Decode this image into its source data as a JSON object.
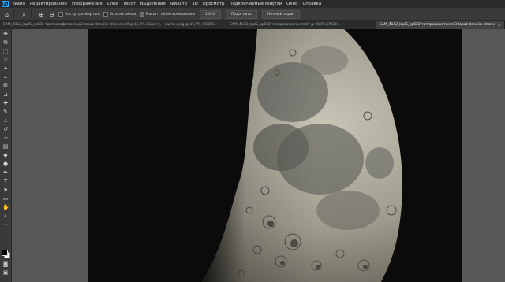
{
  "app": {
    "logo_text": "Ps"
  },
  "menu": [
    "Файл",
    "Редактирование",
    "Изображение",
    "Слои",
    "Текст",
    "Выделение",
    "Фильтр",
    "3D",
    "Просмотр",
    "Подключаемые модули",
    "Окно",
    "Справка"
  ],
  "options_bar": {
    "window_size_label": "Настр. размер окн",
    "all_windows_label": "Во всех окнах",
    "scrubby_zoom_label": "Масшт. перетаскиванием",
    "zoom_value": "100%",
    "fit_screen_label": "Подогнать",
    "full_screen_label": "Полный экран"
  },
  "tabs": [
    {
      "label": "SAM_4112_lapIS_sp622 топпросафотомпрй2-topaz-denoise-sharpen.tif @ 16,7% (Слой 0, RGB/16...",
      "active": false
    },
    {
      "label": "фитон.png @ 16,7% (RGB/1...",
      "active": false
    },
    {
      "label": "SAM_4112_lapIS_sp622 топпросафотомпп.tif @ 20,5% (RGB/...",
      "active": false
    },
    {
      "label": "SAM_4112_lapIS_sp622 топпросафотомпп3-topaz-denoise-sharpen.tif @ 16,7% (RGB/1...",
      "active": true
    }
  ],
  "tools": [
    "move-icon",
    "artboard-icon",
    "marquee-icon",
    "lasso-icon",
    "magic-wand-icon",
    "crop-icon",
    "frame-icon",
    "eyedropper-icon",
    "healing-icon",
    "brush-icon",
    "clone-stamp-icon",
    "history-brush-icon",
    "eraser-icon",
    "gradient-icon",
    "blur-icon",
    "dodge-icon",
    "pen-icon",
    "type-icon",
    "path-select-icon",
    "rectangle-icon",
    "hand-icon",
    "zoom-icon",
    "more-icon"
  ],
  "colors": {
    "foreground": "#000000",
    "background": "#ffffff",
    "accent": "#31a8ff"
  }
}
